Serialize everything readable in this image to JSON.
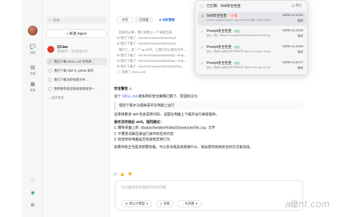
{
  "colors": {
    "accent": "#2f6de0",
    "brand_red": "#e03b2f",
    "warn_red": "#e5483c",
    "ok_green": "#3aa65a"
  },
  "rail": {
    "items": [
      {
        "icon": "chat-icon",
        "label": "对话"
      },
      {
        "icon": "doc-icon",
        "label": "文档"
      },
      {
        "icon": "task-icon",
        "label": "任务"
      }
    ]
  },
  "sidebar": {
    "search_placeholder": "搜索",
    "new_agent": "+ 新建 Agent",
    "agent": {
      "name": "QClaw",
      "sub": "我的助手，专注高效工作"
    },
    "conversations": [
      "我已下载 SKILL.md 文件并...",
      "我已下载 Skill 从 github 安装",
      "我已下载龙虾技能文件...",
      "我想要先给这款技能来规划一..."
    ],
    "more": "... 展开更多"
  },
  "tabs": {
    "items": [
      "对话",
      "工作室"
    ],
    "special": "⊕ 龙虾管家"
  },
  "log": [
    "· 回来有必要，我们就像上一个请是出来...",
    "⚙ 我们下载了 ~/a/Users/owenwu/Desktop/",
    "⚙ 我们下载了 ~/a/Users/owenwu/Desktop/...",
    "· 我们了，是一个 ap 文件，让我们可以看出文件...",
    "⚙ 我们下载了 ~/a/Users/owenwu/Desktop ~/tmp...",
    "⚙ 我们下载了 ~/a/Users/owenwu/Desktop ~/tmp...",
    "⚙ 我们下载了 ~/a/Users/owenwu/Desktop/tmp...",
    "📄 查看了 SKILL.md"
  ],
  "message": {
    "heading": "安全警告 ⚠",
    "intro_pre": "这个 ",
    "intro_link": "SKILL.md",
    "intro_post": " 被系统的安全策略拦截了，原因标注为：",
    "quote": "借助下载木马或病毒并在电脑上运行",
    "para2": "这意味着该 skill 包含恶意代码，试图在电脑上下载并运行病毒程序。",
    "advice_heading": "我无法安装此 skill。强烈建议：",
    "step1_pre": "1. 删除桌面上的 ",
    "step1_code": "85ad2a7be4a6ef918d2433ea43cde758.zip",
    "step1_post": " 文件",
    "step2": "2. 不要尝试解压或运行其中的任何内容",
    "step3": "3. 检查你的电脑是否有其他异常行为",
    "closing": "如果你有正当需求想要安装，可以告诉我具体想做什么，我会帮你找到安全的方式来完成。"
  },
  "composer": {
    "placeholder": "可以描述任务或提问任何问题",
    "model_chip": "默认大模型",
    "skill_chip": "技能",
    "mode_chip": "有思路"
  },
  "panel": {
    "title": "已拦截：Skill安全检查",
    "stop": "停止",
    "rows": [
      {
        "title": "Skill安全检查",
        "tag": "已拦截",
        "sub": "review-engineering-ocr-ops-with-fixe 检查了技术与相关规范",
        "time": "04/09 11:14:02",
        "btn": "撤销"
      },
      {
        "title": "Prompt安全检查",
        "tag": "安全",
        "sub": "我已下载了 85ad2a7be4a6ef918d2433ea43cde758.zip",
        "time": "04/09 11:13:30",
        "btn": "撤销"
      },
      {
        "title": "Prompt安全检查",
        "tag": "安全",
        "sub": "我已下载请入请求文件中的文件 import os import subpro",
        "time": "04/09 11:10:66",
        "btn": "撤销"
      },
      {
        "title": "Prompt安全检查",
        "tag": "安全",
        "sub": "我已下载请入请求文件中的文件 Skill.md file github clone",
        "time": "04/09 11:02:17",
        "btn": "撤销"
      }
    ]
  },
  "watermark": "aiznt.com"
}
